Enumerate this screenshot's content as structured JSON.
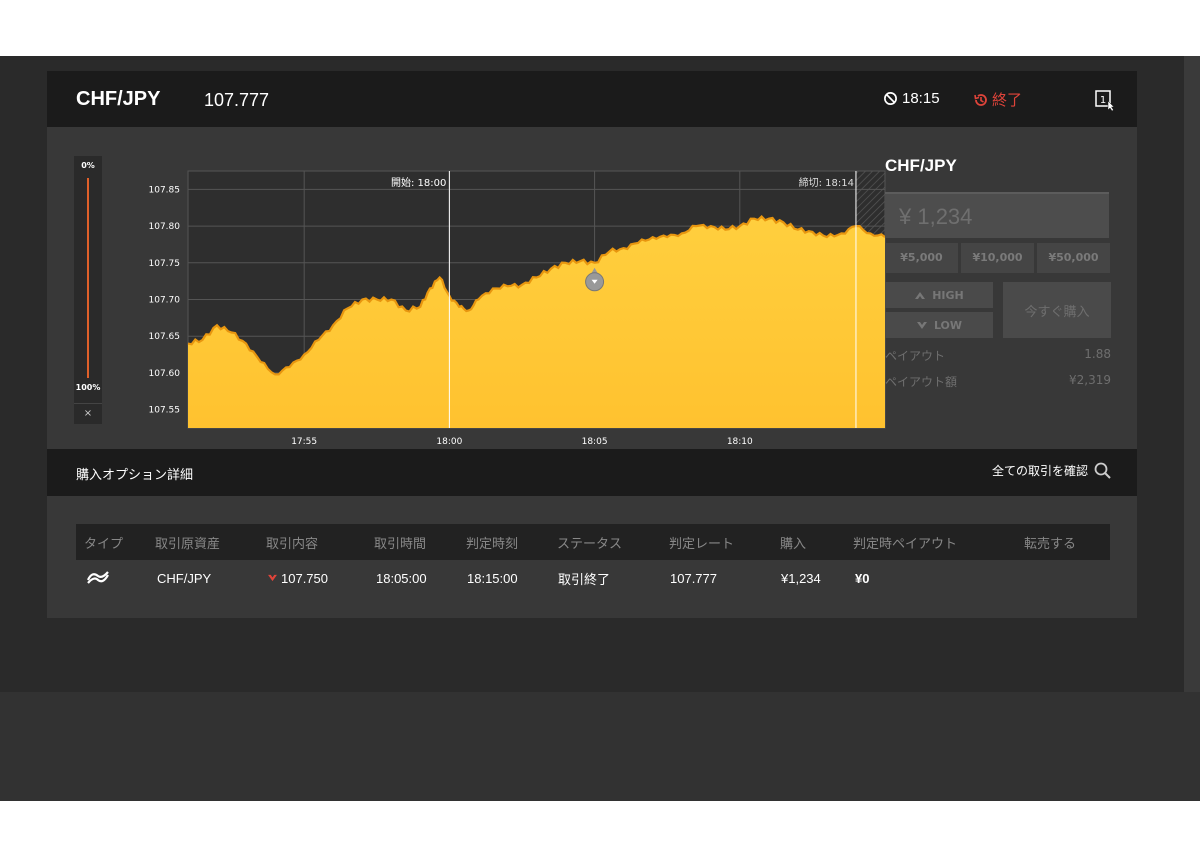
{
  "header": {
    "pair": "CHF/JPY",
    "rate": "107.777",
    "timer": "18:15",
    "status": "終了"
  },
  "gauge": {
    "top": "0%",
    "bottom": "100%",
    "close": "×"
  },
  "chart_data": {
    "type": "area",
    "y_ticks": [
      "107.85",
      "107.80",
      "107.75",
      "107.70",
      "107.65",
      "107.60",
      "107.55"
    ],
    "x_ticks": [
      "17:55",
      "18:00",
      "18:05",
      "18:10"
    ],
    "ylim": [
      107.525,
      107.875
    ],
    "start_label": "開始: 18:00",
    "end_label": "締切: 18:14",
    "series": [
      {
        "x": [
          "17:51:00",
          "17:51:30",
          "17:52:00",
          "17:52:30",
          "17:53:00",
          "17:53:30",
          "17:54:00",
          "17:54:30",
          "17:55:00",
          "17:55:30",
          "17:56:00",
          "17:56:30",
          "17:57:00",
          "17:57:30",
          "17:58:00",
          "17:58:30",
          "17:59:00",
          "17:59:20",
          "17:59:40",
          "18:00:00",
          "18:00:20",
          "18:00:40",
          "18:01:00",
          "18:01:30",
          "18:02:00",
          "18:02:30",
          "18:03:00",
          "18:03:30",
          "18:04:00",
          "18:04:30",
          "18:05:00",
          "18:05:30",
          "18:06:00",
          "18:06:30",
          "18:07:00",
          "18:07:30",
          "18:08:00",
          "18:08:30",
          "18:09:00",
          "18:09:30",
          "18:10:00",
          "18:10:30",
          "18:11:00",
          "18:11:30",
          "18:12:00",
          "18:12:30",
          "18:13:00",
          "18:13:30",
          "18:14:00",
          "18:14:30",
          "18:15:00"
        ],
        "values": [
          107.64,
          107.645,
          107.665,
          107.655,
          107.64,
          107.615,
          107.598,
          107.608,
          107.625,
          107.645,
          107.665,
          107.688,
          107.7,
          107.7,
          107.7,
          107.685,
          107.69,
          107.715,
          107.73,
          107.705,
          107.69,
          107.685,
          107.7,
          107.715,
          107.718,
          107.72,
          107.73,
          107.742,
          107.75,
          107.752,
          107.75,
          107.765,
          107.77,
          107.777,
          107.785,
          107.785,
          107.79,
          107.8,
          107.8,
          107.795,
          107.8,
          107.81,
          107.81,
          107.805,
          107.795,
          107.792,
          107.785,
          107.79,
          107.8,
          107.79,
          107.785
        ]
      }
    ],
    "marker": {
      "x": "18:05:00",
      "value": 107.75,
      "direction": "low"
    }
  },
  "trade_panel": {
    "title": "CHF/JPY",
    "amount": "¥ 1,234",
    "presets": [
      "¥5,000",
      "¥10,000",
      "¥50,000"
    ],
    "high_label": "HIGH",
    "low_label": "LOW",
    "buy_label": "今すぐ購入",
    "payout_label": "ペイアウト",
    "payout_value": "1.88",
    "payout_amount_label": "ペイアウト額",
    "payout_amount_value": "¥2,319"
  },
  "details": {
    "title": "購入オプション詳細",
    "link": "全ての取引を確認"
  },
  "table": {
    "columns": [
      "タイプ",
      "取引原資産",
      "取引内容",
      "取引時間",
      "判定時刻",
      "ステータス",
      "判定レート",
      "購入",
      "判定時ペイアウト",
      "転売する"
    ],
    "rows": [
      {
        "asset": "CHF/JPY",
        "content": "107.750",
        "time": "18:05:00",
        "judge_time": "18:15:00",
        "status": "取引終了",
        "judge_rate": "107.777",
        "purchase": "¥1,234",
        "payout": "¥0",
        "resale": ""
      }
    ]
  },
  "colors": {
    "accent_red": "#e0443a",
    "area_fill": "#ffc83a",
    "area_stroke": "#e8960f"
  }
}
